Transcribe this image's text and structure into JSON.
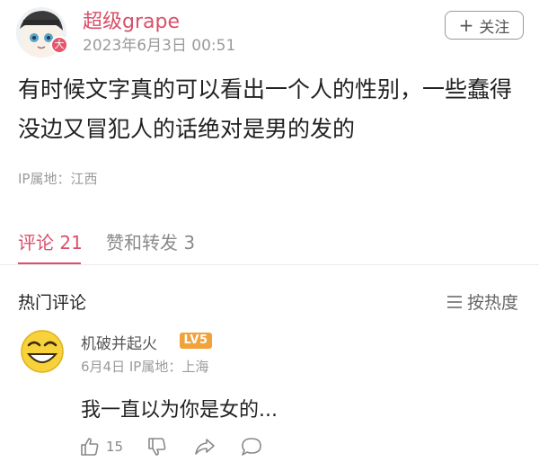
{
  "post": {
    "author": "超级grape",
    "time": "2023年6月3日 00:51",
    "follow_label": "关注",
    "follow_prefix": "+",
    "content": "有时候文字真的可以看出一个人的性别，一些蠢得没边又冒犯人的话绝对是男的发的",
    "ip_label": "IP属地：江西",
    "avatar_badge_char": "大"
  },
  "tabs": {
    "comments": "评论 21",
    "likes_shares": "赞和转发 3"
  },
  "hot_comments": {
    "title": "热门评论",
    "sort_label": "按热度"
  },
  "comment": {
    "name": "机破并起火",
    "level_badge": "LV5",
    "meta": "6月4日  IP属地：上海",
    "text": "我一直以为你是女的...",
    "like_count": "15"
  },
  "colors": {
    "accent": "#d9506a",
    "badge": "#f2a23a",
    "muted": "#9a9a9a"
  },
  "icons": [
    "thumbs-up-icon",
    "thumbs-down-icon",
    "share-icon",
    "comment-icon",
    "sort-icon",
    "emoji-avatar-icon"
  ]
}
